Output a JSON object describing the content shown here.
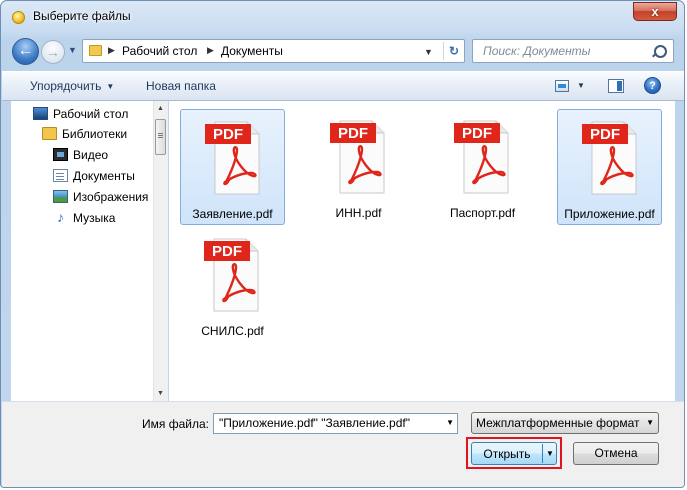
{
  "window": {
    "title": "Выберите файлы",
    "close_glyph": "x"
  },
  "nav": {
    "back_glyph": "←",
    "forward_glyph": "→"
  },
  "address": {
    "crumbs": [
      "Рабочий стол",
      "Документы"
    ],
    "refresh_glyph": "↻"
  },
  "search": {
    "placeholder": "Поиск: Документы"
  },
  "toolbar": {
    "organize_label": "Упорядочить",
    "new_folder_label": "Новая папка",
    "help_glyph": "?"
  },
  "sidebar": {
    "items": [
      {
        "label": "Рабочий стол",
        "icon": "desktop-icon"
      },
      {
        "label": "Библиотеки",
        "icon": "libraries-icon"
      },
      {
        "label": "Видео",
        "icon": "video-icon"
      },
      {
        "label": "Документы",
        "icon": "documents-icon"
      },
      {
        "label": "Изображения",
        "icon": "images-icon"
      },
      {
        "label": "Музыка",
        "icon": "music-icon"
      }
    ]
  },
  "files": [
    {
      "name": "Заявление.pdf",
      "selected": true
    },
    {
      "name": "ИНН.pdf",
      "selected": false
    },
    {
      "name": "Паспорт.pdf",
      "selected": false
    },
    {
      "name": "Приложение.pdf",
      "selected": true
    },
    {
      "name": "СНИЛС.pdf",
      "selected": false
    }
  ],
  "pdf_badge_text": "PDF",
  "footer": {
    "filename_label": "Имя файла:",
    "filename_value": "\"Приложение.pdf\" \"Заявление.pdf\"",
    "filetype_value": "Межплатформенные формат",
    "open_label": "Открыть",
    "cancel_label": "Отмена"
  },
  "colors": {
    "pdf_red": "#e0251b",
    "highlight_red": "#e0141c",
    "selection_blue": "#cfe4fa"
  }
}
